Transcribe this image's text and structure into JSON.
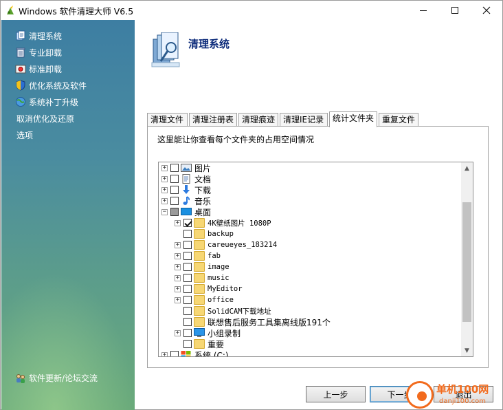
{
  "window": {
    "title": "Windows 软件清理大师 V6.5"
  },
  "sidebar": {
    "items": [
      {
        "label": "清理系统",
        "icon": "files-icon"
      },
      {
        "label": "专业卸载",
        "icon": "trash-icon"
      },
      {
        "label": "标准卸载",
        "icon": "uninstall-icon"
      },
      {
        "label": "优化系统及软件",
        "icon": "shield-icon"
      },
      {
        "label": "系统补丁升级",
        "icon": "globe-icon"
      },
      {
        "label": "取消优化及还原",
        "icon": ""
      },
      {
        "label": "选项",
        "icon": ""
      }
    ],
    "footer": "软件更新/论坛交流"
  },
  "header": {
    "title": "清理系统"
  },
  "tabs": [
    {
      "label": "清理文件"
    },
    {
      "label": "清理注册表"
    },
    {
      "label": "清理痕迹"
    },
    {
      "label": "清理IE记录"
    },
    {
      "label": "统计文件夹",
      "active": true
    },
    {
      "label": "重复文件"
    }
  ],
  "panel": {
    "description": "这里能让你查看每个文件夹的占用空间情况"
  },
  "tree": {
    "rows": [
      {
        "label": "图片",
        "level": 0,
        "expander": "+",
        "check": "none",
        "icon": "pictures-icon"
      },
      {
        "label": "文档",
        "level": 0,
        "expander": "+",
        "check": "none",
        "icon": "documents-icon"
      },
      {
        "label": "下载",
        "level": 0,
        "expander": "+",
        "check": "none",
        "icon": "download-icon"
      },
      {
        "label": "音乐",
        "level": 0,
        "expander": "+",
        "check": "none",
        "icon": "music-icon"
      },
      {
        "label": "桌面",
        "level": 0,
        "expander": "-",
        "check": "partial",
        "icon": "desktop-icon"
      },
      {
        "label": "4K壁纸图片 1080P",
        "level": 1,
        "expander": "+",
        "check": "checked",
        "icon": "folder-icon"
      },
      {
        "label": "backup",
        "level": 1,
        "expander": "",
        "check": "none",
        "icon": "folder-icon"
      },
      {
        "label": "careueyes_183214",
        "level": 1,
        "expander": "+",
        "check": "none",
        "icon": "folder-icon"
      },
      {
        "label": "fab",
        "level": 1,
        "expander": "+",
        "check": "none",
        "icon": "folder-icon"
      },
      {
        "label": "image",
        "level": 1,
        "expander": "+",
        "check": "none",
        "icon": "folder-icon"
      },
      {
        "label": "music",
        "level": 1,
        "expander": "+",
        "check": "none",
        "icon": "folder-icon"
      },
      {
        "label": "MyEditor",
        "level": 1,
        "expander": "+",
        "check": "none",
        "icon": "folder-icon"
      },
      {
        "label": "office",
        "level": 1,
        "expander": "+",
        "check": "none",
        "icon": "folder-icon"
      },
      {
        "label": "SolidCAM下载地址",
        "level": 1,
        "expander": "",
        "check": "none",
        "icon": "folder-icon"
      },
      {
        "label": "联想售后服务工具集离线版191个",
        "level": 1,
        "expander": "",
        "check": "none",
        "icon": "folder-icon"
      },
      {
        "label": "小组录制",
        "level": 1,
        "expander": "+",
        "check": "none",
        "icon": "monitor-icon"
      },
      {
        "label": "重要",
        "level": 1,
        "expander": "",
        "check": "none",
        "icon": "folder-icon"
      },
      {
        "label": "系统 (C:)",
        "level": 0,
        "expander": "+",
        "check": "none",
        "icon": "drive-icon"
      }
    ]
  },
  "buttons": {
    "prev": "上一步",
    "next": "下一步",
    "exit": "退出"
  },
  "watermark": {
    "title": "单机100网",
    "url": "danji100.com"
  },
  "colors": {
    "sidebar_top": "#3d7ea2",
    "sidebar_bottom": "#6aaa7a",
    "header_title": "#0b2a7a",
    "watermark": "#f26b1d"
  }
}
